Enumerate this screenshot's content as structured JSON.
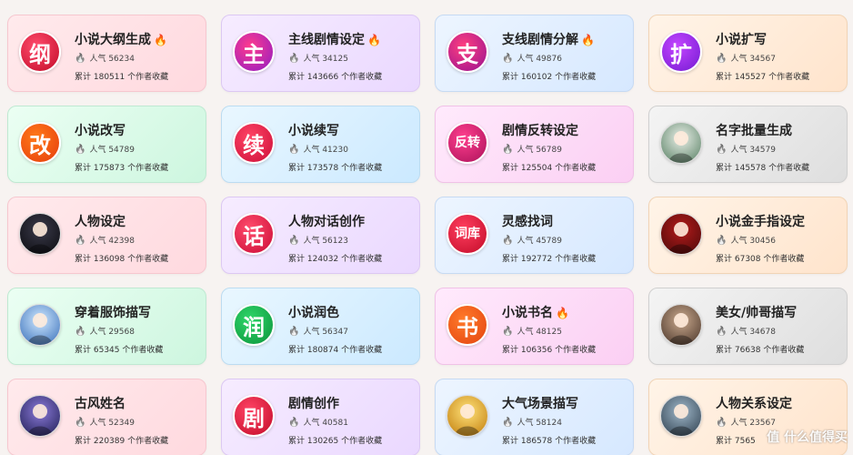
{
  "cards": [
    {
      "title": "小说大纲生成",
      "hot": true,
      "icon": "纲",
      "icon_name": "gang-icon",
      "pop": "人气 56234",
      "total": "累计 180511 个作者收藏",
      "theme": "pink",
      "c1": "#ff4d6d",
      "c2": "#c8102e"
    },
    {
      "title": "主线剧情设定",
      "hot": true,
      "icon": "主",
      "icon_name": "zhu-icon",
      "pop": "人气 34125",
      "total": "累计 143666 个作者收藏",
      "theme": "purple",
      "c1": "#ff3b8d",
      "c2": "#9b1fbf"
    },
    {
      "title": "支线剧情分解",
      "hot": true,
      "icon": "支",
      "icon_name": "zhi-icon",
      "pop": "人气 49876",
      "total": "累计 160102 个作者收藏",
      "theme": "blue",
      "c1": "#ff3f7f",
      "c2": "#a2168f"
    },
    {
      "title": "小说扩写",
      "hot": false,
      "icon": "扩",
      "icon_name": "kuo-icon",
      "pop": "人气 34567",
      "total": "累计 145527 个作者收藏",
      "theme": "peach",
      "c1": "#c445ff",
      "c2": "#7b1fd6"
    },
    {
      "title": "小说改写",
      "hot": false,
      "icon": "改",
      "icon_name": "gai-icon",
      "pop": "人气 54789",
      "total": "累计 175873 个作者收藏",
      "theme": "mint",
      "c1": "#ff7a1a",
      "c2": "#e8420c"
    },
    {
      "title": "小说续写",
      "hot": false,
      "icon": "续",
      "icon_name": "xu-icon",
      "pop": "人气 41230",
      "total": "累计 173578 个作者收藏",
      "theme": "sky",
      "c1": "#ff4466",
      "c2": "#d1143c"
    },
    {
      "title": "剧情反转设定",
      "hot": false,
      "icon": "反转",
      "icon_name": "fanzhuan-icon",
      "pop": "人气 56789",
      "total": "累计 125504 个作者收藏",
      "theme": "magenta",
      "c1": "#ff3f8e",
      "c2": "#b3165f"
    },
    {
      "title": "名字批量生成",
      "hot": false,
      "icon": "",
      "icon_name": "anime-girl-avatar",
      "pop": "人气 34579",
      "total": "累计 145578 个作者收藏",
      "theme": "gray",
      "c1": "#e9efe8",
      "c2": "#6a8e74"
    },
    {
      "title": "人物设定",
      "hot": false,
      "icon": "",
      "icon_name": "dark-hair-girl-avatar",
      "pop": "人气 42398",
      "total": "累计 136098 个作者收藏",
      "theme": "pink",
      "c1": "#3a3a4a",
      "c2": "#121218"
    },
    {
      "title": "人物对话创作",
      "hot": false,
      "icon": "话",
      "icon_name": "hua-icon",
      "pop": "人气 56123",
      "total": "累计 124032 个作者收藏",
      "theme": "purple",
      "c1": "#ff4d6d",
      "c2": "#d0113b"
    },
    {
      "title": "灵感找词",
      "hot": false,
      "icon": "词库",
      "icon_name": "ciku-icon",
      "pop": "人气 45789",
      "total": "累计 192772 个作者收藏",
      "theme": "blue",
      "c1": "#ff3f5f",
      "c2": "#c8102e"
    },
    {
      "title": "小说金手指设定",
      "hot": false,
      "icon": "",
      "icon_name": "golden-finger-avatar",
      "pop": "人气 30456",
      "total": "累计 67308 个作者收藏",
      "theme": "peach",
      "c1": "#b31b1b",
      "c2": "#5a0c0c"
    },
    {
      "title": "穿着服饰描写",
      "hot": false,
      "icon": "",
      "icon_name": "armored-boy-avatar",
      "pop": "人气 29568",
      "total": "累计 65345 个作者收藏",
      "theme": "mint",
      "c1": "#cfe8ff",
      "c2": "#4c7fc2"
    },
    {
      "title": "小说润色",
      "hot": false,
      "icon": "润",
      "icon_name": "run-icon",
      "pop": "人气 56347",
      "total": "累计 180874 个作者收藏",
      "theme": "sky",
      "c1": "#2fd66a",
      "c2": "#0f9a3f"
    },
    {
      "title": "小说书名",
      "hot": true,
      "icon": "书",
      "icon_name": "shu-icon",
      "pop": "人气 48125",
      "total": "累计 106356 个作者收藏",
      "theme": "magenta",
      "c1": "#ff7a2a",
      "c2": "#e64a12"
    },
    {
      "title": "美女/帅哥描写",
      "hot": false,
      "icon": "",
      "icon_name": "couple-avatar",
      "pop": "人气 34678",
      "total": "累计 76638 个作者收藏",
      "theme": "gray",
      "c1": "#c9a98e",
      "c2": "#5a4436"
    },
    {
      "title": "古风姓名",
      "hot": false,
      "icon": "",
      "icon_name": "ancient-warrior-avatar",
      "pop": "人气 52349",
      "total": "累计 220389 个作者收藏",
      "theme": "pink",
      "c1": "#8a7ad8",
      "c2": "#2e2a66"
    },
    {
      "title": "剧情创作",
      "hot": false,
      "icon": "剧",
      "icon_name": "ju-icon",
      "pop": "人气 40581",
      "total": "累计 130265 个作者收藏",
      "theme": "purple",
      "c1": "#ff4466",
      "c2": "#c8102e"
    },
    {
      "title": "大气场景描写",
      "hot": false,
      "icon": "",
      "icon_name": "palace-scene-avatar",
      "pop": "人气 58124",
      "total": "累计 186578 个作者收藏",
      "theme": "blue",
      "c1": "#ffe27a",
      "c2": "#c98a1a"
    },
    {
      "title": "人物关系设定",
      "hot": false,
      "icon": "",
      "icon_name": "two-characters-avatar",
      "pop": "人气 23567",
      "total": "累计 7565",
      "theme": "peach",
      "c1": "#9fb7c9",
      "c2": "#3d4f5e"
    }
  ],
  "watermark": "值 什么值得买"
}
